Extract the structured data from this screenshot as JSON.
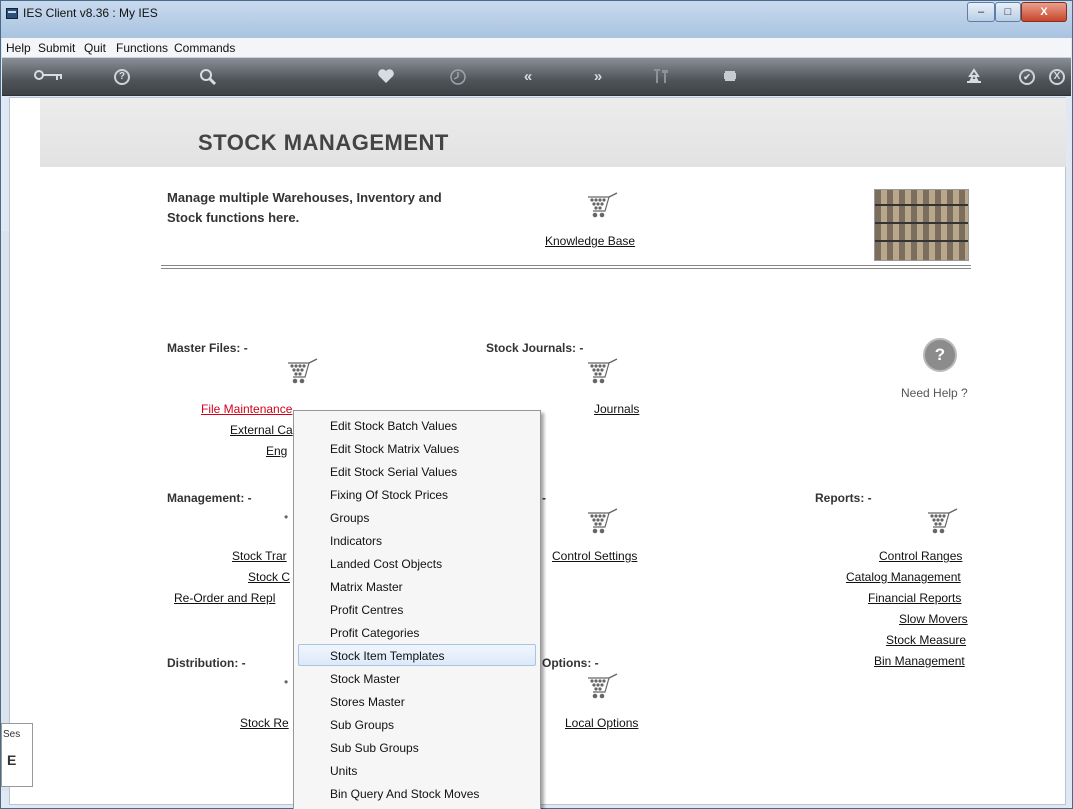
{
  "window": {
    "title": "IES Client v8.36 : My IES",
    "min_label": "–",
    "max_label": "□",
    "close_label": "X"
  },
  "menubar": [
    "Help",
    "Submit",
    "Quit",
    "Functions",
    "Commands"
  ],
  "toolbar": {
    "icons": [
      "key-icon",
      "help-icon",
      "search-icon",
      "heart-icon",
      "clock-icon",
      "rewind-icon",
      "fast-forward-icon",
      "tools-icon",
      "stop-icon",
      "recycle-icon",
      "check-icon",
      "close-icon"
    ],
    "help_glyph": "?",
    "check_glyph": "✔",
    "close_glyph": "X"
  },
  "page": {
    "title": "STOCK MANAGEMENT",
    "description_line1": "Manage multiple Warehouses, Inventory and",
    "description_line2": "Stock functions here.",
    "knowledge_base": "Knowledge Base",
    "need_help": "Need Help ?",
    "help_glyph": "?"
  },
  "sections": {
    "master_files": {
      "label": "Master Files: -",
      "links": [
        "File Maintenance",
        "External Ca",
        "Eng"
      ]
    },
    "stock_journals": {
      "label": "Stock Journals: -",
      "links": [
        "Journals"
      ]
    },
    "management": {
      "label": "Management: -",
      "links": [
        "Stock Trar",
        "Stock C",
        "Re-Order and Repl"
      ]
    },
    "center_mid": {
      "label": "-",
      "links": [
        "Control Settings"
      ]
    },
    "reports": {
      "label": "Reports: -",
      "links": [
        "Control Ranges",
        "Catalog Management",
        "Financial Reports",
        "Slow Movers",
        "Stock Measure",
        "Bin Management"
      ]
    },
    "distribution": {
      "label": "Distribution: -",
      "links": [
        "Stock Re"
      ]
    },
    "options": {
      "label": "Options: -",
      "links": [
        "Local Options"
      ]
    }
  },
  "session_tab": {
    "label": "Ses",
    "glyph": "E"
  },
  "popup_menu": {
    "items": [
      "Edit Stock Batch Values",
      "Edit Stock Matrix Values",
      "Edit Stock Serial Values",
      "Fixing Of Stock Prices",
      "Groups",
      "Indicators",
      "Landed Cost Objects",
      "Matrix Master",
      "Profit Centres",
      "Profit Categories",
      "Stock Item Templates",
      "Stock Master",
      "Stores Master",
      "Sub Groups",
      "Sub Sub Groups",
      "Units",
      "Bin Query And Stock Moves"
    ],
    "highlighted": "Stock Item Templates"
  }
}
